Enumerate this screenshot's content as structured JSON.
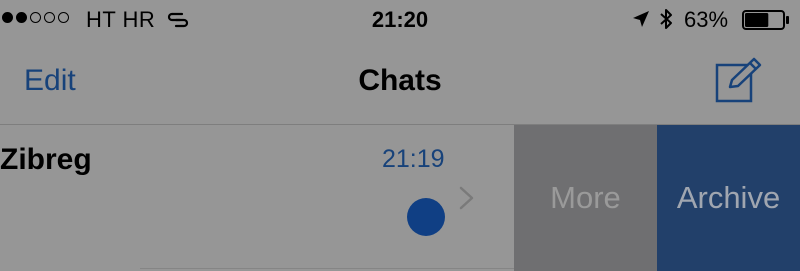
{
  "status_bar": {
    "signal_strength": 2,
    "signal_total": 5,
    "carrier": "HT HR",
    "time": "21:20",
    "battery_percent": "63%",
    "battery_level": 0.63,
    "icons": [
      "wifi-calling-icon",
      "location-arrow-icon",
      "bluetooth-icon",
      "battery-icon"
    ]
  },
  "nav": {
    "edit_label": "Edit",
    "title": "Chats",
    "compose_icon": "compose-icon"
  },
  "chats": [
    {
      "name": "Zibreg",
      "time": "21:19",
      "unread": true,
      "actions": {
        "more_label": "More",
        "archive_label": "Archive"
      }
    }
  ],
  "colors": {
    "accent": "#17427a",
    "unread_badge": "#103f84",
    "more_bg": "#6f6f71",
    "archive_bg": "#22406a",
    "background": "#969696"
  }
}
